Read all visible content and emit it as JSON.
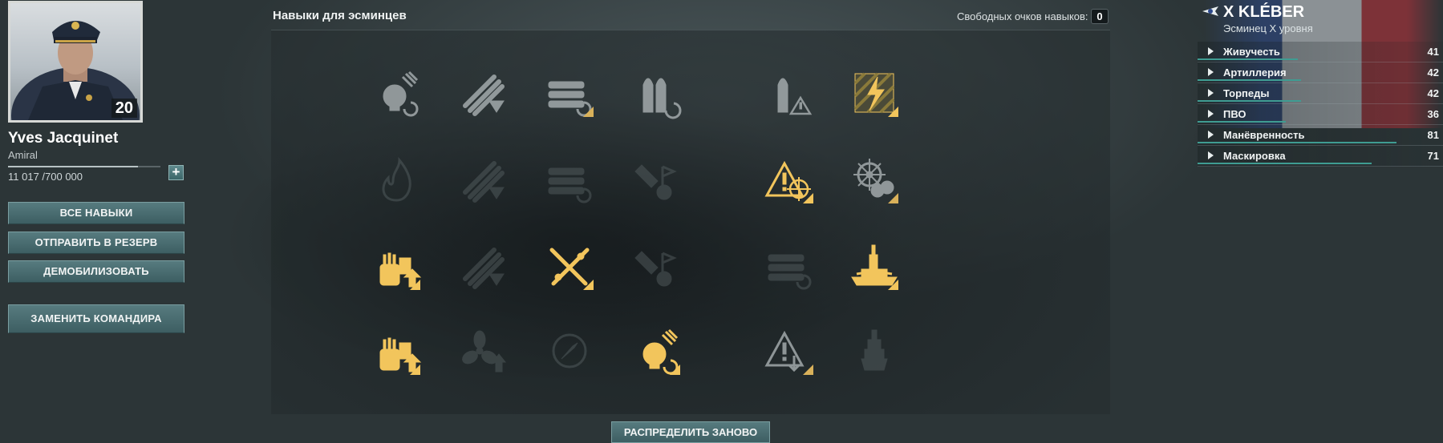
{
  "commander": {
    "name": "Yves Jacquinet",
    "rank": "Amiral",
    "level": "20",
    "xp_text": "11 017 /700 000",
    "xp_progress": 0.85
  },
  "left_buttons": {
    "all_skills": "ВСЕ НАВЫКИ",
    "reserve": "ОТПРАВИТЬ В РЕЗЕРВ",
    "demobilize": "ДЕМОБИЛИЗОВАТЬ",
    "replace": "ЗАМЕНИТЬ КОМАНДИРА"
  },
  "skills": {
    "title": "Навыки для эсминцев",
    "free_points_label": "Свободных очков навыков:",
    "free_points": "0",
    "redistribute": "РАСПРЕДЕЛИТЬ ЗАНОВО",
    "grid": [
      [
        {
          "icon": "secondary-reload-icon",
          "state": "available"
        },
        {
          "icon": "torpedo-tubes-icon",
          "state": "available"
        },
        {
          "icon": "torpedo-reload-icon",
          "state": "learned"
        },
        {
          "icon": "shells-reload-icon",
          "state": "available"
        },
        {
          "icon": "ammo-warning-icon",
          "state": "available"
        },
        {
          "icon": "lightning-hazard-icon",
          "state": "learned-active"
        }
      ],
      [
        {
          "icon": "fire-icon",
          "state": "locked"
        },
        {
          "icon": "torpedo-tubes-icon",
          "state": "locked"
        },
        {
          "icon": "torpedo-reload-icon",
          "state": "locked"
        },
        {
          "icon": "flag-repair-icon",
          "state": "locked"
        },
        {
          "icon": "target-warning-icon",
          "state": "learned-active"
        },
        {
          "icon": "steering-gear-icon",
          "state": "learned"
        }
      ],
      [
        {
          "icon": "gun-turret-upgrade-icon",
          "state": "learned-active"
        },
        {
          "icon": "torpedo-tubes-icon",
          "state": "locked"
        },
        {
          "icon": "crossed-torpedoes-icon",
          "state": "learned-active"
        },
        {
          "icon": "flag-repair-icon",
          "state": "locked"
        },
        {
          "icon": "torpedo-reload-icon",
          "state": "locked"
        },
        {
          "icon": "battleship-icon",
          "state": "learned-active"
        }
      ],
      [
        {
          "icon": "gun-turret-upgrade-icon",
          "state": "learned-active"
        },
        {
          "icon": "propeller-upgrade-icon",
          "state": "locked"
        },
        {
          "icon": "compass-icon",
          "state": "locked"
        },
        {
          "icon": "secondary-reload-icon",
          "state": "learned-active"
        },
        {
          "icon": "warning-down-icon",
          "state": "learned"
        },
        {
          "icon": "ship-silhouette-icon",
          "state": "locked"
        }
      ]
    ]
  },
  "ship": {
    "name": "X KLÉBER",
    "class": "Эсминец X уровня",
    "stats": [
      {
        "label": "Живучесть",
        "value": "41",
        "fraction": 0.41
      },
      {
        "label": "Артиллерия",
        "value": "42",
        "fraction": 0.42
      },
      {
        "label": "Торпеды",
        "value": "42",
        "fraction": 0.42
      },
      {
        "label": "ПВО",
        "value": "36",
        "fraction": 0.36
      },
      {
        "label": "Манёвренность",
        "value": "81",
        "fraction": 0.81
      },
      {
        "label": "Маскировка",
        "value": "71",
        "fraction": 0.71
      }
    ]
  },
  "colors": {
    "accent": "#f2c55c",
    "button": "#4a6d71",
    "stat_bar": "#3f9c92"
  }
}
